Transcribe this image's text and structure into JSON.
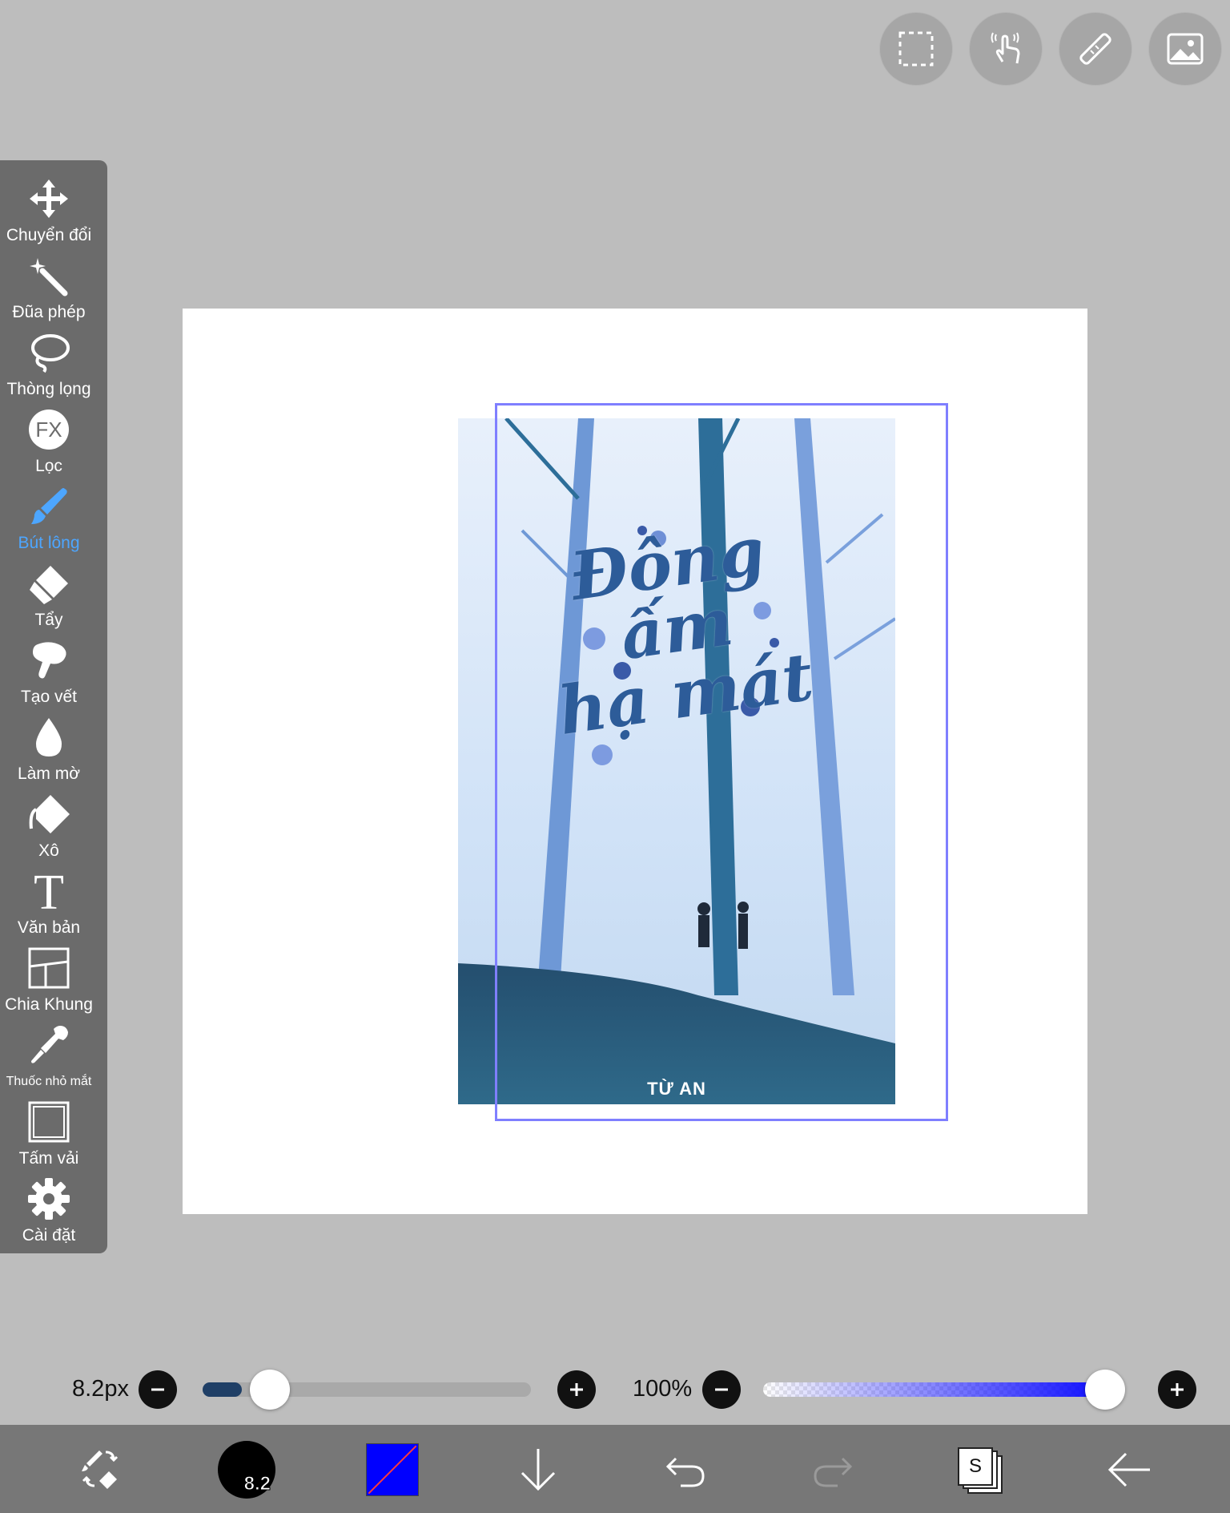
{
  "toolbar": {
    "tools": [
      {
        "label": "Chuyển đổi",
        "icon": "transform-icon"
      },
      {
        "label": "Đũa phép",
        "icon": "magic-wand-icon"
      },
      {
        "label": "Thòng lọng",
        "icon": "lasso-icon"
      },
      {
        "label": "Lọc",
        "icon": "fx-filter-icon",
        "glyph": "FX"
      },
      {
        "label": "Bút lông",
        "icon": "brush-icon",
        "active": true
      },
      {
        "label": "Tẩy",
        "icon": "eraser-icon"
      },
      {
        "label": "Tạo vết",
        "icon": "smudge-icon"
      },
      {
        "label": "Làm mờ",
        "icon": "blur-icon"
      },
      {
        "label": "Xô",
        "icon": "bucket-icon"
      },
      {
        "label": "Văn bản",
        "icon": "text-icon",
        "glyph": "T"
      },
      {
        "label": "Chia Khung",
        "icon": "frame-divider-icon"
      },
      {
        "label": "Thuốc nhỏ mắt",
        "icon": "eyedropper-icon"
      },
      {
        "label": "Tấm vải",
        "icon": "canvas-icon"
      },
      {
        "label": "Cài đặt",
        "icon": "settings-icon"
      }
    ]
  },
  "top_buttons": [
    "selection-icon",
    "touch-gesture-icon",
    "ruler-icon",
    "image-icon"
  ],
  "cover": {
    "title_line1": "Đông",
    "title_line2": "ấm",
    "title_line3": "hạ mát",
    "author": "TỪ AN"
  },
  "brush": {
    "size_label": "8.2px",
    "size_preview": "8.2",
    "size_fraction": 0.12,
    "opacity_label": "100%",
    "opacity_fraction": 1.0
  },
  "colors": {
    "accent_active": "#4da6ff",
    "current_color": "#0000ff",
    "selection_border": "#7f7fff"
  },
  "bottom_bar": {
    "layers_glyph": "S"
  }
}
